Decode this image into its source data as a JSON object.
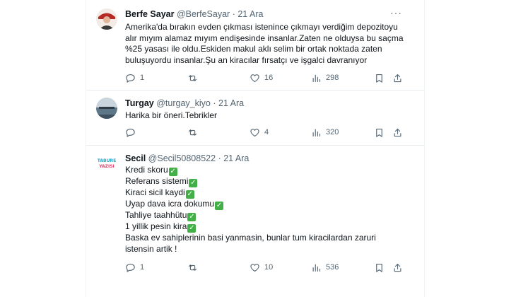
{
  "tweets": [
    {
      "name": "Berfe Sayar",
      "handle": "@BerfeSayar",
      "sep": "·",
      "date": "21 Ara",
      "lines": [
        "Amerika'da bırakın evden çıkması istenince çıkmayı verdiğim depozitoyu",
        "alır mıyım alamaz mıyım endişesinde insanlar.Zaten ne olduysa bu saçma",
        "%25 yasası ile oldu.Eskiden makul aklı selim bir ortak noktada zaten",
        "buluşuyordu insanlar.Şu an kiracılar fırsatçı ve işgalci davranıyor"
      ],
      "replies": "1",
      "retweets": "",
      "likes": "16",
      "views": "298"
    },
    {
      "name": "Turgay",
      "handle": "@turgay_kiyo",
      "sep": "·",
      "date": "21 Ara",
      "lines": [
        "Harika bir öneri.Tebrikler"
      ],
      "replies": "",
      "retweets": "",
      "likes": "4",
      "views": "320"
    },
    {
      "name": "Secil",
      "handle": "@Secil50808522",
      "sep": "·",
      "date": "21 Ara",
      "avatar_text": "TABURE YAZISI",
      "lines": [
        "Kredi skoru",
        "Referans sistemi",
        "Kiraci sicil kaydi",
        "Uyap dava icra dokumu",
        "Tahliye taahhütu",
        "1 yillik pesin kira",
        "Baska ev sahiplerinin basi yanmasin, bunlar tum kiracilardan zaruri",
        "istensin artik !"
      ],
      "check_glyph": "✓",
      "replies": "1",
      "retweets": "",
      "likes": "10",
      "views": "536"
    }
  ],
  "icons": {
    "more": "more-icon",
    "reply": "reply-icon",
    "retweet": "retweet-icon",
    "like": "like-icon",
    "views": "views-icon",
    "bookmark": "bookmark-icon",
    "share": "share-icon"
  },
  "colors": {
    "text": "#0f1419",
    "muted": "#536471",
    "divider": "#e6ecf0",
    "check": "#43b047"
  }
}
